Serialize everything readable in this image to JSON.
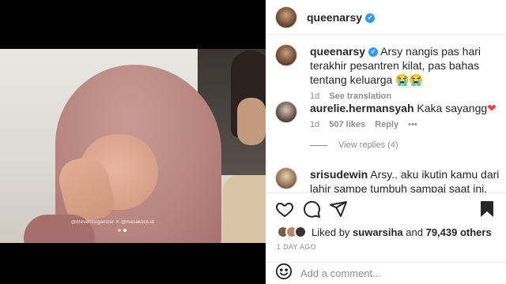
{
  "post": {
    "author": "queenarsy",
    "caption": "Arsy nangis pas hari terakhir pesantren kilat, pas bahas tentang keluarga",
    "caption_emoji": "😭😭",
    "caption_time": "1d",
    "translate_label": "See translation",
    "watermark": "@dteventorganizer  ✕  @masakocil.id"
  },
  "comments": [
    {
      "user": "aurelie.hermansyah",
      "text": "Kaka sayangg",
      "emoji": "❤",
      "time": "1d",
      "likes": "507 likes",
      "reply": "Reply",
      "more": "•••"
    },
    {
      "user": "srisudewin",
      "text": "Arsy.. aku ikutin kamu dari lahir sampe tumbuh sampai saat ini. Sayang online",
      "time": "",
      "likes": "",
      "reply": ""
    }
  ],
  "view_replies": "View replies (4)",
  "likes": {
    "prefix": "Liked by",
    "user": "suwarsiha",
    "and": "and",
    "others": "79,439 others"
  },
  "time_ago": "1 DAY AGO",
  "add_comment_placeholder": "Add a comment...",
  "icons": {
    "like": "heart-icon",
    "comment": "comment-icon",
    "share": "share-icon",
    "save": "bookmark-icon",
    "emoji": "smiley-icon"
  },
  "colors": {
    "verified": "#3897f0",
    "heart": "#ed4956",
    "muted": "#8e8e8e"
  }
}
